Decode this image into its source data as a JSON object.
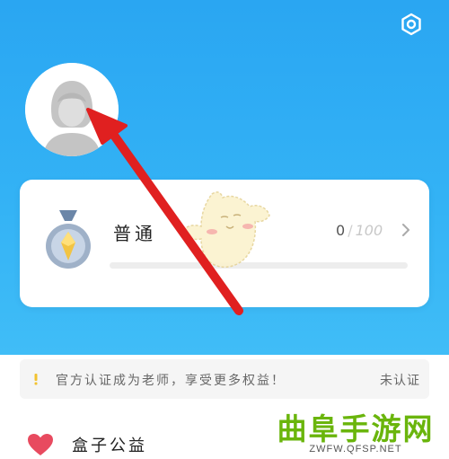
{
  "header": {
    "settings_icon": "gear-icon",
    "background_color": "#2aa6f2"
  },
  "profile": {
    "avatar_icon": "default-avatar-icon"
  },
  "level_card": {
    "medal_icon": "medal-icon",
    "level_name": "普通",
    "current_points": "0",
    "separator": "/",
    "max_points": "100",
    "progress_fraction": 0,
    "chevron_icon": "chevron-right-icon",
    "accent_color": "#2aa6f2"
  },
  "notice": {
    "icon": "info-icon",
    "text": "官方认证成为老师，享受更多权益！",
    "status": "未认证"
  },
  "menu": {
    "items": [
      {
        "icon": "heart-icon",
        "label": "盒子公益"
      }
    ]
  },
  "watermark": {
    "title": "曲阜手游网",
    "url": "ZWFW.QFSP.NET"
  },
  "annotation": {
    "arrow_color": "#e02020"
  }
}
